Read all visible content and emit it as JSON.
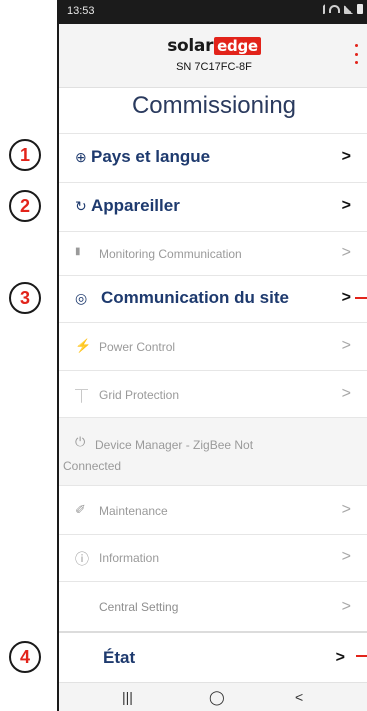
{
  "status": {
    "time": "13:53"
  },
  "header": {
    "logo_part1": "solar",
    "logo_part2": "edge",
    "serial": "SN 7C17FC-8F"
  },
  "page_title": "Commissioning",
  "menu": [
    {
      "label": "Pays et langue",
      "icon": "globe-icon",
      "emphasized": true
    },
    {
      "label": "Appareiller",
      "icon": "sync-icon",
      "emphasized": true
    },
    {
      "label": "Monitoring Communication",
      "icon": "bar-chart-icon",
      "emphasized": false
    },
    {
      "label": "Communication du site",
      "icon": "location-pin-icon",
      "emphasized": true
    },
    {
      "label": "Power Control",
      "icon": "lightning-icon",
      "emphasized": false
    },
    {
      "label": "Grid Protection",
      "icon": "power-tower-icon",
      "emphasized": false
    },
    {
      "label": "Device Manager - ZigBee Not Connected",
      "icon": "plug-icon",
      "emphasized": false
    },
    {
      "label": "Maintenance",
      "icon": "wrench-icon",
      "emphasized": false
    },
    {
      "label": "Information",
      "icon": "info-icon",
      "emphasized": false
    },
    {
      "label": "Central Setting",
      "icon": "",
      "emphasized": false
    },
    {
      "label": "État",
      "icon": "",
      "emphasized": true
    }
  ],
  "annotations": [
    "1",
    "2",
    "3",
    "4"
  ],
  "glyphs": {
    "chevron": ">",
    "globe": "⊕",
    "sync": "↻",
    "bars": "▮",
    "pin": "◎",
    "bolt": "⚡",
    "tower": "⏉",
    "plug": "⏻",
    "wrench": "✐",
    "info": "ⓘ",
    "nav_recent": "|||",
    "nav_home": "◯",
    "nav_back": "<"
  },
  "colors": {
    "accent": "#e2231a",
    "title": "#2a3a5e",
    "item_emphasized": "#1e3a6e",
    "item_disabled": "#9a9a9a"
  }
}
